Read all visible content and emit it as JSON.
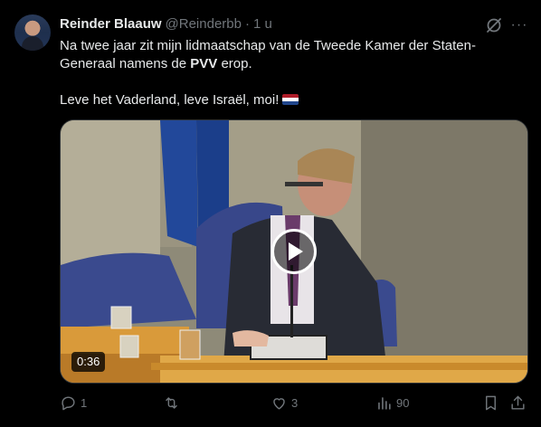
{
  "post": {
    "author_name": "Reinder Blaauw",
    "author_handle": "@Reinderbb",
    "separator": "·",
    "time": "1 u",
    "more_label": "···",
    "text_line1_pre": "Na twee jaar zit mijn lidmaatschap van de Tweede Kamer der Staten-Generaal namens de ",
    "text_line1_bold": "PVV",
    "text_line1_post": " erop.",
    "text_line2": "Leve het Vaderland, leve Israël, moi!",
    "flag_emoji": "netherlands-flag-emoji",
    "flag_colors": [
      "#ae1c28",
      "#ffffff",
      "#21468b"
    ]
  },
  "media": {
    "type": "video",
    "duration": "0:36",
    "play_icon": "play-icon"
  },
  "actions": {
    "replies": "1",
    "reposts": "",
    "likes": "3",
    "views": "90"
  },
  "colors": {
    "background": "#000000",
    "text": "#e7e9ea",
    "muted": "#71767b",
    "border": "#2f3336"
  }
}
